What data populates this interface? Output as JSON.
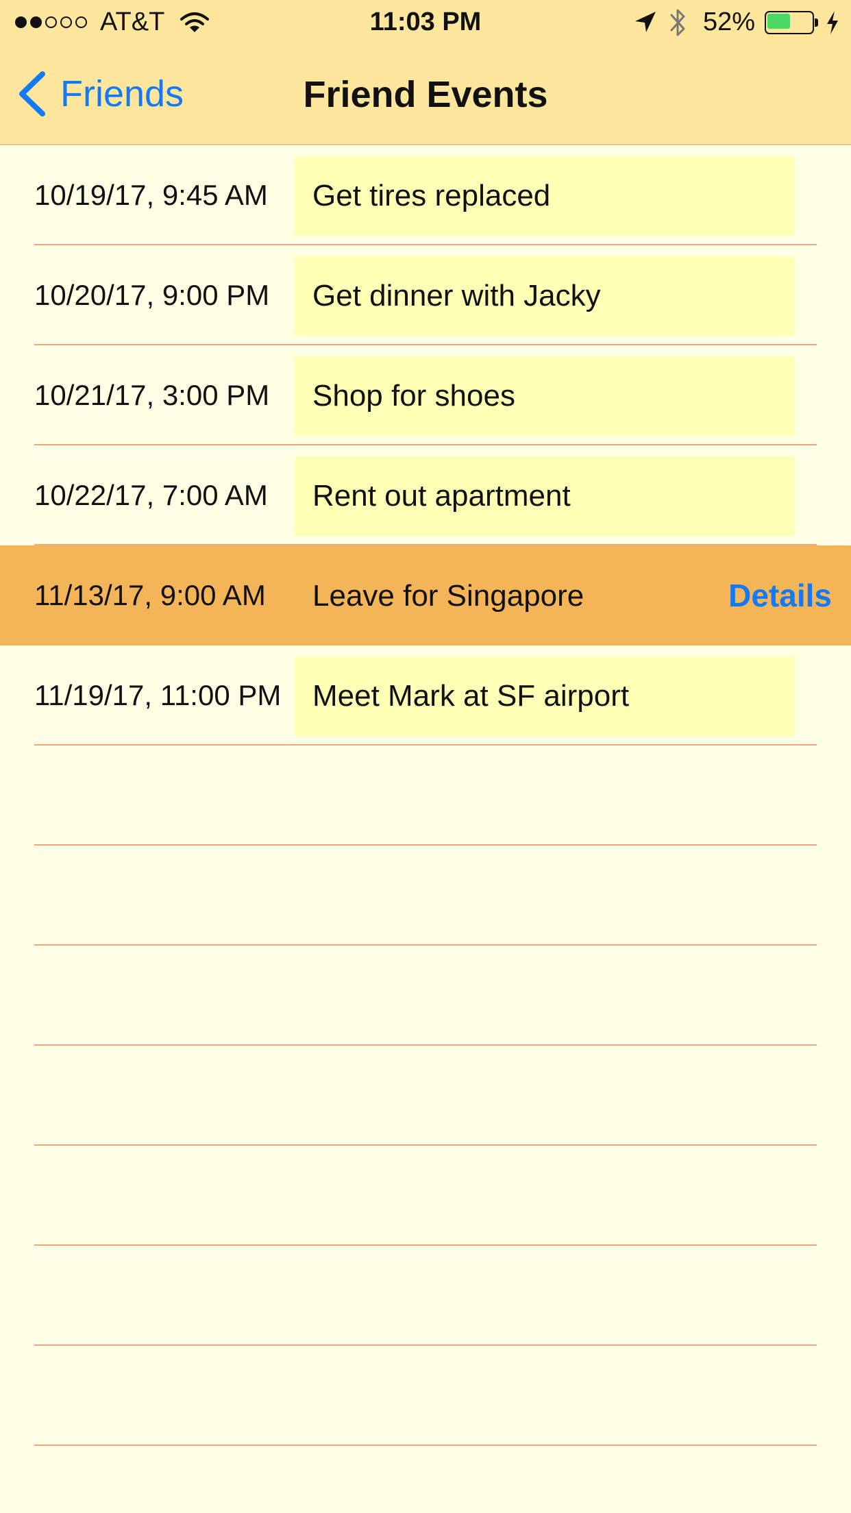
{
  "status_bar": {
    "signal_dots_full": 2,
    "signal_dots_total": 5,
    "carrier": "AT&T",
    "time": "11:03 PM",
    "battery_percent_text": "52%",
    "battery_level": 0.52,
    "battery_color": "#4cd964"
  },
  "nav": {
    "back_label": "Friends",
    "title": "Friend Events",
    "accent_color": "#1479f5"
  },
  "events": [
    {
      "date": "10/19/17, 9:45 AM",
      "title": "Get tires replaced"
    },
    {
      "date": "10/20/17, 9:00 PM",
      "title": "Get dinner with Jacky"
    },
    {
      "date": "10/21/17, 3:00 PM",
      "title": "Shop for shoes"
    },
    {
      "date": "10/22/17, 7:00 AM",
      "title": "Rent out apartment"
    },
    {
      "date": "11/13/17, 9:00 AM",
      "title": "Leave for Singapore",
      "selected": true,
      "action_label": "Details"
    },
    {
      "date": "11/19/17, 11:00 PM",
      "title": "Meet Mark at SF airport"
    }
  ],
  "colors": {
    "header_background": "#fee69c",
    "list_background": "#ffffe6",
    "title_box_background": "#ffffb6",
    "selected_row_background": "#f4b558",
    "separator": "#f5a57a"
  }
}
